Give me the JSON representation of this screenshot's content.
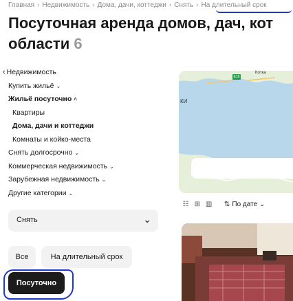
{
  "breadcrumbs": [
    "Главная",
    "Недвижимость",
    "Дома, дачи, коттеджи",
    "Снять",
    "На длительный срок"
  ],
  "breadcrumb_separator": "›",
  "title_line1": "Посуточная аренда домов, дач, кот",
  "title_line2": "области",
  "title_count": "6",
  "sidebar": {
    "back": "Недвижимость",
    "items": [
      {
        "label": "Купить жильё",
        "chevron": "down"
      },
      {
        "label": "Жильё посуточно",
        "chevron": "up",
        "active": true
      }
    ],
    "subitems": [
      "Квартиры",
      "Дома, дачи и коттеджи",
      "Комнаты и койко-места"
    ],
    "items_after": [
      "Снять долгосрочно",
      "Коммерческая недвижимость",
      "Зарубежная недвижимость",
      "Другие категории"
    ]
  },
  "select": {
    "value": "Снять"
  },
  "pills": {
    "all": "Все",
    "long_term": "На длительный срок",
    "daily": "Посуточно"
  },
  "map": {
    "label_city": "Котка",
    "label_partial": "КИ",
    "road_badge": "E18"
  },
  "sort": {
    "label": "По дате"
  },
  "colors": {
    "accent_blue": "#2436c4",
    "active_pill": "#1c1c1c",
    "map_water": "#b9d7ea",
    "map_land": "#e6efd9"
  }
}
